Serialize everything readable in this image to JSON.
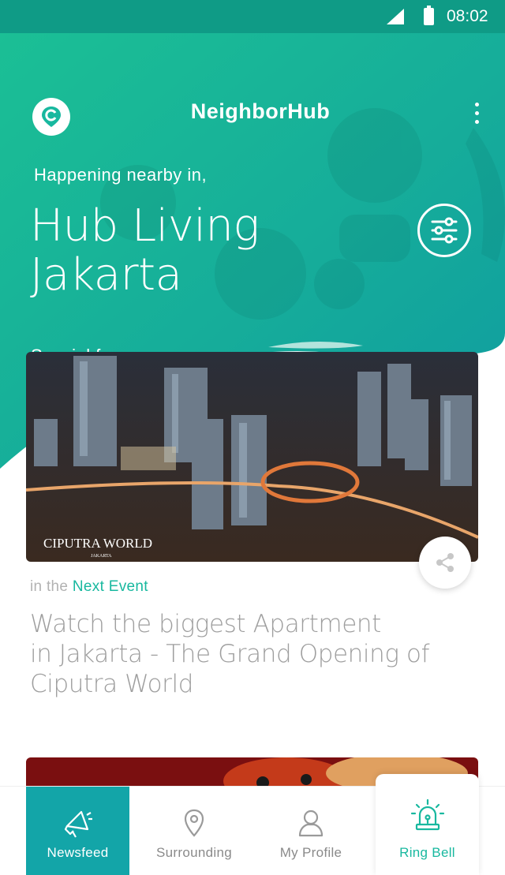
{
  "status_bar": {
    "time": "08:02"
  },
  "header": {
    "app_title": "NeighborHub"
  },
  "hero": {
    "nearby_label": "Happening nearby in,",
    "location_line1": "Hub Living",
    "location_line2": "Jakarta",
    "section_label": "Special for you"
  },
  "event_card": {
    "image_logo_text": "CIPUTRA WORLD",
    "image_logo_subtext": "JAKARTA",
    "kicker_prefix": "in the",
    "kicker_accent": "Next Event",
    "title_line1": "Watch the biggest Apartment",
    "title_line2": "in Jakarta - The Grand Opening of",
    "title_line3": "Ciputra World"
  },
  "bottom_nav": {
    "items": [
      {
        "label": "Newsfeed",
        "icon": "megaphone-icon",
        "active": true
      },
      {
        "label": "Surrounding",
        "icon": "location-pin-icon"
      },
      {
        "label": "My Profile",
        "icon": "user-icon"
      },
      {
        "label": "Ring Bell",
        "icon": "alarm-siren-icon"
      }
    ]
  },
  "colors": {
    "primary": "#13a5a8",
    "accent_green": "#18b89f",
    "status_bar": "#0f9b86"
  }
}
